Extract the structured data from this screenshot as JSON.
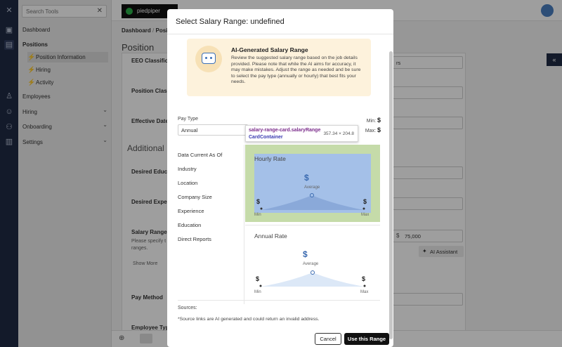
{
  "nav": {
    "search_placeholder": "Search Tools",
    "items": [
      {
        "label": "Dashboard"
      },
      {
        "label": "Positions"
      },
      {
        "label": "Position Information"
      },
      {
        "label": "Hiring"
      },
      {
        "label": "Activity"
      },
      {
        "label": "Employees"
      },
      {
        "label": "Hiring"
      },
      {
        "label": "Onboarding"
      },
      {
        "label": "Settings"
      }
    ]
  },
  "header": {
    "logo_text": "piedpiper",
    "breadcrumb_root": "Dashboard",
    "breadcrumb_current": "Positi"
  },
  "background": {
    "page_title": "Position",
    "eeo_label": "EEO Classificatio",
    "pos_class_label": "Position Classifi",
    "effective_date_label": "Effective Date",
    "additional_heading": "Additional",
    "desired_edu_label": "Desired Educati",
    "desired_exp_label": "Desired Experie",
    "salary_range_label": "Salary Range",
    "salary_help_1": "Please specify t",
    "salary_help_2": "ranges.",
    "show_more": "Show More",
    "pay_method_label": "Pay Method",
    "employee_type_label": "Employee Type",
    "eeo_value_fragment": "rs",
    "max_salary_value": "75,000",
    "currency_symbol": "$",
    "ai_assistant": "AI Assistant"
  },
  "modal": {
    "title": "Select Salary Range: undefined",
    "ai_title": "AI-Generated Salary Range",
    "ai_text": "Review the suggested salary range based on the job details provided. Please note that while the AI aims for accuracy, it may make mistakes. Adjust the range as needed and be sure to select the pay type (annually or hourly) that best fits your needs.",
    "pay_type_label": "Pay Type",
    "pay_type_value": "Annual",
    "min_label": "Min:",
    "max_label": "Max:",
    "currency": "$",
    "tooltip": {
      "line1": "salary-range-card.salaryRange",
      "line2": "CardContainer",
      "dims": "357.34 × 204.8"
    },
    "side_items": [
      "Data Current As Of",
      "Industry",
      "Location",
      "Company Size",
      "Experience",
      "Education",
      "Direct Reports"
    ],
    "hourly": {
      "title": "Hourly Rate",
      "average": "Average",
      "min": "Min",
      "max": "Max"
    },
    "annual": {
      "title": "Annual Rate",
      "average": "Average",
      "min": "Min",
      "max": "Max"
    },
    "sources_label": "Sources:",
    "note": "*Source links are AI generated and could return an invalid address.",
    "cancel": "Cancel",
    "use": "Use this Range"
  }
}
